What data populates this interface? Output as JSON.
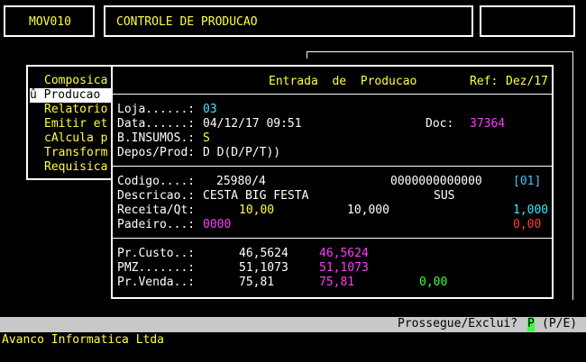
{
  "header": {
    "program_code": "MOV010",
    "title": "CONTROLE DE PRODUCAO"
  },
  "menu": {
    "items": [
      {
        "label": "Composica",
        "selected": false
      },
      {
        "label": "û Producao",
        "selected": true
      },
      {
        "label": "Relatorio",
        "selected": false
      },
      {
        "label": "Emitir et",
        "selected": false
      },
      {
        "label": "cAlcula p",
        "selected": false
      },
      {
        "label": "Transform",
        "selected": false
      },
      {
        "label": "Requisica",
        "selected": false
      }
    ]
  },
  "dialog": {
    "title": "Entrada  de  Producao",
    "ref_label": "Ref:",
    "ref_value": "Dez/17",
    "fields": {
      "loja_label": "Loja......:",
      "loja_value": "03",
      "data_label": "Data......:",
      "data_value": "04/12/17 09:51",
      "doc_label": "Doc:",
      "doc_value": "37364",
      "binsumos_label": "B.INSUMOS.:",
      "binsumos_value": "S",
      "depos_label": "Depos/Prod:",
      "depos_value": "D D(D/P/T))"
    },
    "product": {
      "codigo_label": "Codigo....:",
      "codigo_value": "25980/4",
      "barcode": "0000000000000",
      "bracket": "[01]",
      "descricao_label": "Descricao.:",
      "descricao_value": "CESTA BIG FESTA",
      "sus": "SUS",
      "receita_label": "Receita/Qt:",
      "receita_value": "10,00",
      "qt_value": "10,000",
      "factor": "1,000",
      "padeiro_label": "Padeiro...:",
      "padeiro_value": "0000",
      "padeiro_extra": "0,00"
    },
    "prices": {
      "custo_label": "Pr.Custo..:",
      "custo_value": "46,5624",
      "custo_value2": "46,5624",
      "pmz_label": "PMZ.......:",
      "pmz_value": "51,1073",
      "pmz_value2": "51,1073",
      "venda_label": "Pr.Venda..:",
      "venda_value": "75,81",
      "venda_value2": "75,81",
      "venda_value3": "0,00"
    }
  },
  "status_bar": {
    "prompt": "Prossegue/Exclui?",
    "answer": "P",
    "options": "(P/E)"
  },
  "footer": {
    "company": "Avanco Informatica Ltda"
  },
  "colors": {
    "background": "#000000",
    "text": "#ffffff",
    "highlight": "#ffff3c",
    "status_bar": "#c8c8c8"
  }
}
